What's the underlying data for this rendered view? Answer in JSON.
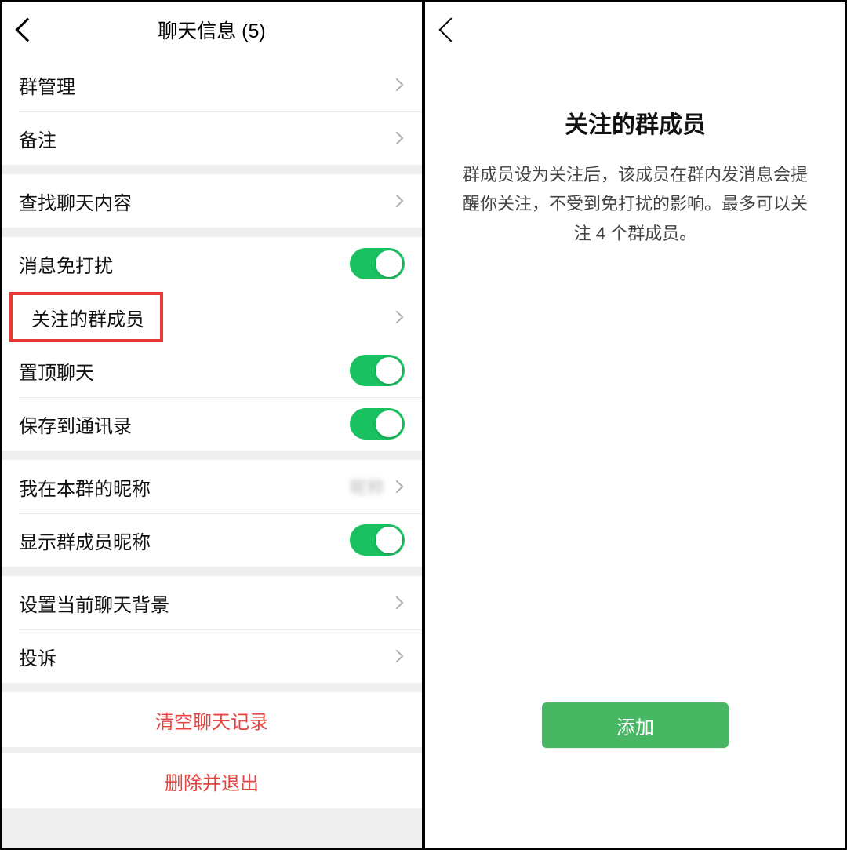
{
  "left": {
    "title": "聊天信息 (5)",
    "rows": {
      "group_manage": "群管理",
      "remark": "备注",
      "search": "查找聊天内容",
      "mute": "消息免打扰",
      "follow_members": "关注的群成员",
      "pin": "置顶聊天",
      "save_contacts": "保存到通讯录",
      "my_alias": "我在本群的昵称",
      "show_alias": "显示群成员昵称",
      "chat_bg": "设置当前聊天背景",
      "complaint": "投诉",
      "clear_history": "清空聊天记录",
      "leave": "删除并退出"
    },
    "toggles": {
      "mute": true,
      "pin": true,
      "save_contacts": true,
      "show_alias": true
    },
    "colors": {
      "accent": "#19c160",
      "danger": "#e64340",
      "highlight": "#e53935"
    }
  },
  "right": {
    "title": "关注的群成员",
    "desc": "群成员设为关注后，该成员在群内发消息会提醒你关注，不受到免打扰的影响。最多可以关注 4 个群成员。",
    "add_label": "添加"
  }
}
